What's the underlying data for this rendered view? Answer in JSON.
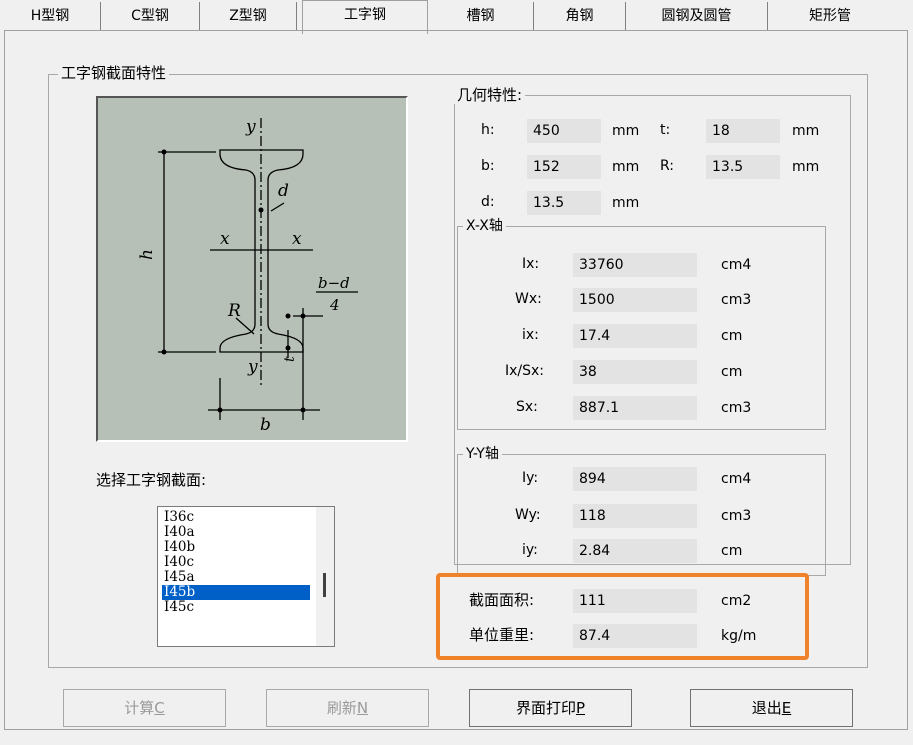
{
  "tabs": [
    {
      "label": "H型钢",
      "active": false
    },
    {
      "label": "C型钢",
      "active": false
    },
    {
      "label": "Z型钢",
      "active": false
    },
    {
      "label": "工字钢",
      "active": true
    },
    {
      "label": "槽钢",
      "active": false
    },
    {
      "label": "角钢",
      "active": false
    },
    {
      "label": "圆钢及圆管",
      "active": false
    },
    {
      "label": "矩形管",
      "active": false
    }
  ],
  "section_group": {
    "title": "工字钢截面特性"
  },
  "diagram": {
    "labels": {
      "y_top": "y",
      "y_bottom": "y",
      "x_left": "x",
      "x_right": "x",
      "h": "h",
      "d": "d",
      "r": "R",
      "t": "t",
      "b": "b",
      "bd_num": "b−d",
      "bd_den": "4"
    }
  },
  "select_label": "选择工字钢截面:",
  "section_list": {
    "items": [
      "I36c",
      "I40a",
      "I40b",
      "I40c",
      "I45a",
      "I45b",
      "I45c"
    ],
    "selected": "I45b"
  },
  "geometry": {
    "title": "几何特性:",
    "h": {
      "label": "h:",
      "value": "450",
      "unit": "mm"
    },
    "t": {
      "label": "t:",
      "value": "18",
      "unit": "mm"
    },
    "b": {
      "label": "b:",
      "value": "152",
      "unit": "mm"
    },
    "r": {
      "label": "R:",
      "value": "13.5",
      "unit": "mm"
    },
    "d": {
      "label": "d:",
      "value": "13.5",
      "unit": "mm"
    }
  },
  "xx_axis": {
    "title": "X-X轴",
    "ix": {
      "label": "Ix:",
      "value": "33760",
      "unit": "cm4"
    },
    "wx": {
      "label": "Wx:",
      "value": "1500",
      "unit": "cm3"
    },
    "rx": {
      "label": "ix:",
      "value": "17.4",
      "unit": "cm"
    },
    "ixsx": {
      "label": "Ix/Sx:",
      "value": "38",
      "unit": "cm"
    },
    "sx": {
      "label": "Sx:",
      "value": "887.1",
      "unit": "cm3"
    }
  },
  "yy_axis": {
    "title": "Y-Y轴",
    "iy": {
      "label": "Iy:",
      "value": "894",
      "unit": "cm4"
    },
    "wy": {
      "label": "Wy:",
      "value": "118",
      "unit": "cm3"
    },
    "ry": {
      "label": "iy:",
      "value": "2.84",
      "unit": "cm"
    }
  },
  "section_area": {
    "label": "截面面积:",
    "value": "111",
    "unit": "cm2"
  },
  "unit_weight": {
    "label": "单位重里:",
    "value": "87.4",
    "unit": "kg/m"
  },
  "buttons": {
    "calc": {
      "label": "计算C",
      "accel": "C",
      "prefix": "计算",
      "enabled": false
    },
    "refresh": {
      "label": "刷新N",
      "prefix": "刷新",
      "accel": "N",
      "enabled": false
    },
    "print": {
      "label": "界面打印P",
      "prefix": "界面打印",
      "accel": "P",
      "enabled": true
    },
    "exit": {
      "label": "退出E",
      "prefix": "退出",
      "accel": "E",
      "enabled": true
    }
  },
  "colors": {
    "highlight": "#f0822a",
    "selection": "#0060c8",
    "drawing_bg": "#b6c0b6"
  }
}
